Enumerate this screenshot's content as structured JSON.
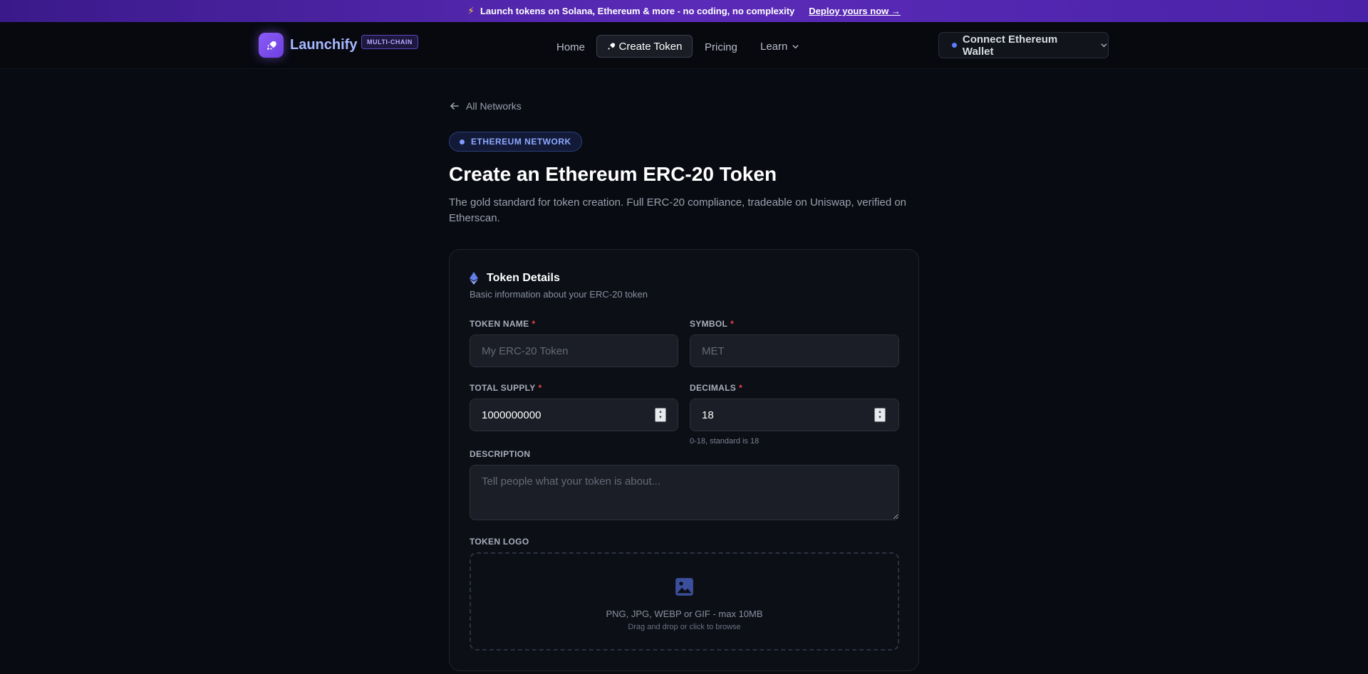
{
  "announcement": {
    "icon": "lightning-bolt-icon",
    "text": "Launch tokens on Solana, Ethereum & more - no coding, no complexity",
    "cta": "Deploy yours now →"
  },
  "header": {
    "brand": "Launchify",
    "badge": "MULTI-CHAIN",
    "nav": {
      "home": "Home",
      "create": "Create Token",
      "pricing": "Pricing",
      "learn": "Learn"
    },
    "connect_button": "Connect Ethereum Wallet"
  },
  "page": {
    "back_link": "All Networks",
    "network_pill": "ETHEREUM NETWORK",
    "title": "Create an Ethereum ERC-20 Token",
    "subtitle": "The gold standard for token creation. Full ERC-20 compliance, tradeable on Uniswap, verified on Etherscan."
  },
  "card": {
    "title": "Token Details",
    "subtitle": "Basic information about your ERC-20 token",
    "fields": {
      "token_name": {
        "label": "TOKEN NAME",
        "placeholder": "My ERC-20 Token",
        "value": ""
      },
      "symbol": {
        "label": "SYMBOL",
        "placeholder": "MET",
        "value": ""
      },
      "total_supply": {
        "label": "TOTAL SUPPLY",
        "value": "1000000000"
      },
      "decimals": {
        "label": "DECIMALS",
        "value": "18",
        "hint": "0-18, standard is 18"
      },
      "description": {
        "label": "DESCRIPTION",
        "placeholder": "Tell people what your token is about..."
      },
      "token_logo": {
        "label": "TOKEN LOGO",
        "formats": "PNG, JPG, WEBP or GIF - max 10MB",
        "instruction": "Drag and drop or click to browse"
      }
    },
    "required_marker": "*"
  },
  "colors": {
    "accent": "#8b5cf6",
    "ethereum": "#627eea",
    "background": "#090b12",
    "required": "#ef4444"
  }
}
